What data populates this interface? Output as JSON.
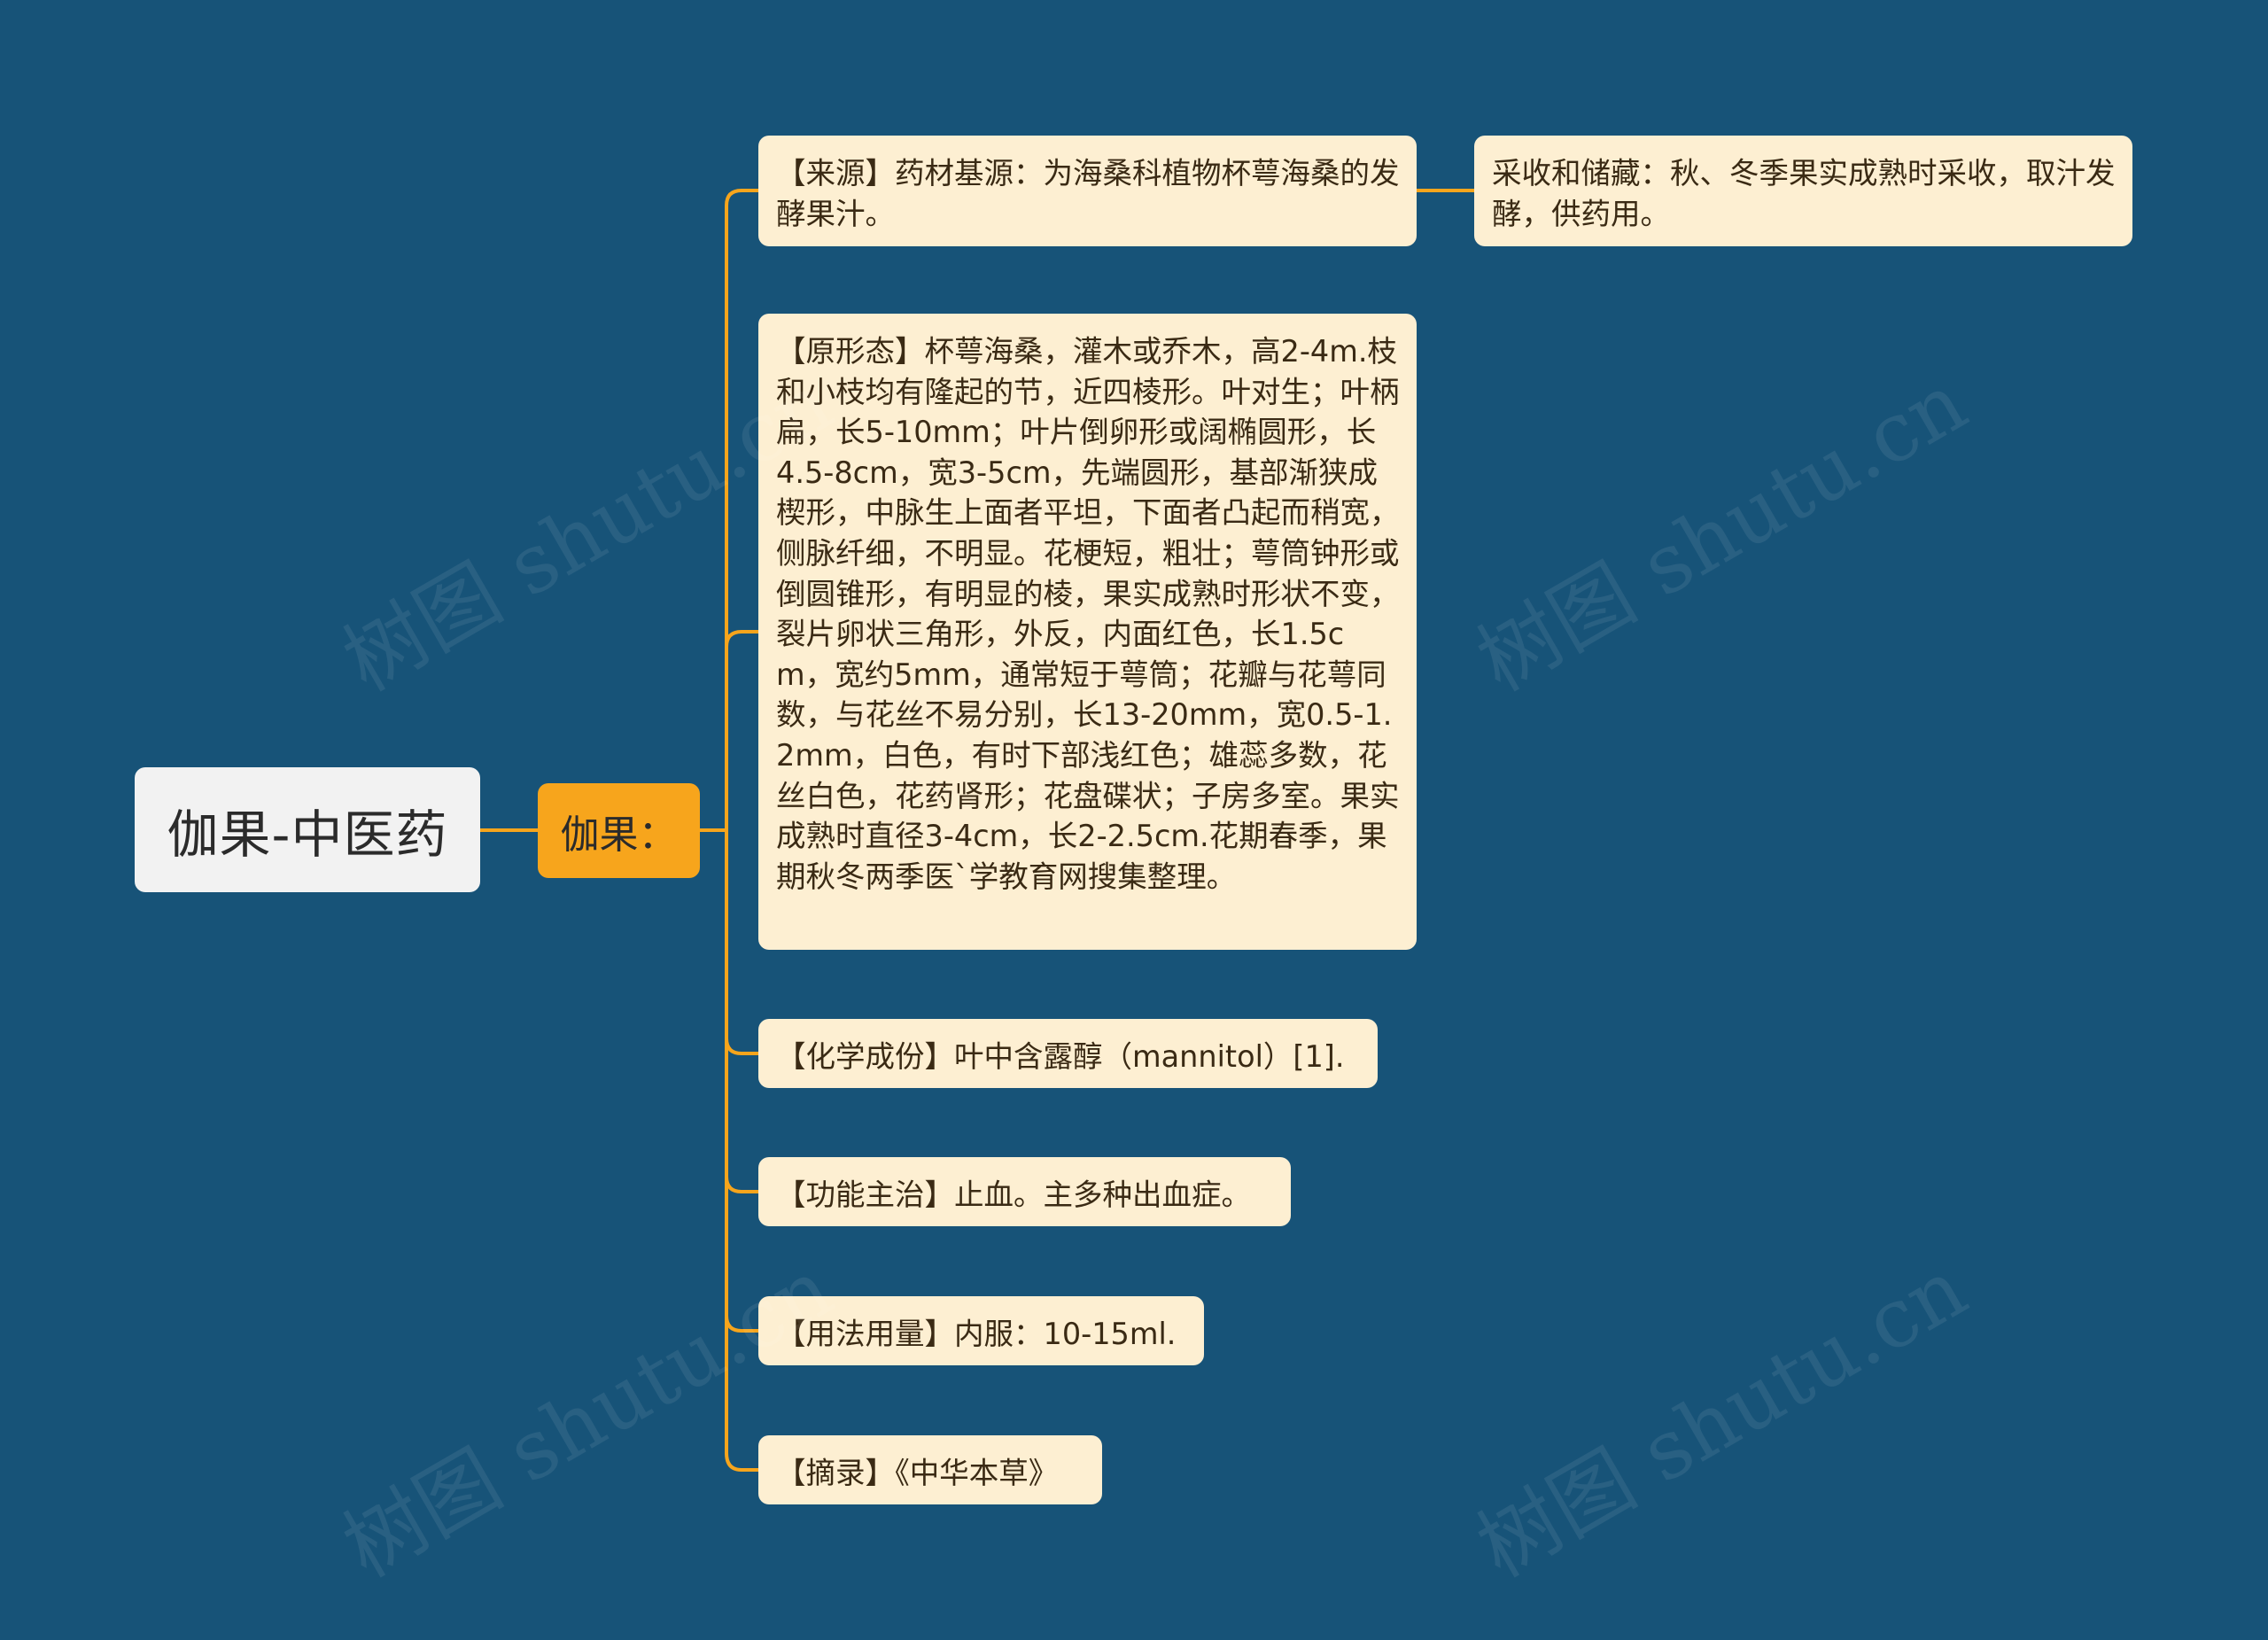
{
  "mindmap": {
    "root": {
      "label": "伽果-中医药"
    },
    "branch": {
      "label": "伽果："
    },
    "leaves": [
      {
        "text": "【来源】药材基源：为海桑科植物杯萼海桑的发酵果汁。"
      },
      {
        "text": "【原形态】杯萼海桑，灌木或乔木，高2-4m.枝和小枝均有隆起的节，近四棱形。叶对生；叶柄扁，长5-10mm；叶片倒卵形或阔椭圆形，长4.5-8cm，宽3-5cm，先端圆形，基部渐狭成楔形，中脉生上面者平坦，下面者凸起而稍宽，侧脉纤细，不明显。花梗短，粗壮；萼筒钟形或倒圆锥形，有明显的棱，果实成熟时形状不变，裂片卵状三角形，外反，内面红色，长1.5cm，宽约5mm，通常短于萼筒；花瓣与花萼同数，与花丝不易分别，长13-20mm，宽0.5-1.2mm，白色，有时下部浅红色；雄蕊多数，花丝白色，花药肾形；花盘碟状；子房多室。果实成熟时直径3-4cm，长2-2.5cm.花期春季，果期秋冬两季医`学教育网搜集整理。"
      },
      {
        "text": "【化学成份】叶中含露醇（mannitol）[1]."
      },
      {
        "text": "【功能主治】止血。主多种出血症。"
      },
      {
        "text": "【用法用量】内服：10-15ml."
      },
      {
        "text": "【摘录】《中华本草》"
      }
    ],
    "sub_leaf": {
      "text": "采收和储藏：秋、冬季果实成熟时采收，取汁发酵，供药用。"
    }
  },
  "watermark": {
    "text": "树图 shutu.cn"
  },
  "colors": {
    "background": "#175378",
    "connector": "#f7a51c",
    "branch_fill": "#f7a51c",
    "leaf_fill": "#fdefd2",
    "root_fill": "#f2f2f2"
  }
}
